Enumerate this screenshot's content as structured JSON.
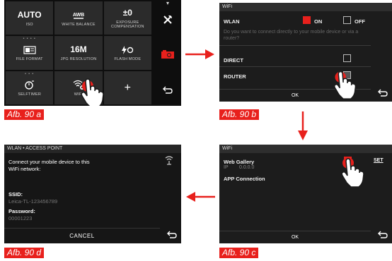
{
  "screen_a": {
    "cells": [
      {
        "value": "AUTO",
        "label": "ISO"
      },
      {
        "value": "AWB",
        "label": "WHITE BALANCE"
      },
      {
        "value": "±0",
        "label": "EXPOSURE\nCOMPENSATION"
      },
      {
        "value": "",
        "label": "FILE FORMAT"
      },
      {
        "value": "16M",
        "label": "JPG RESOLUTION"
      },
      {
        "value": "",
        "label": "FLASH MODE"
      },
      {
        "value": "",
        "label": "SELFTIMER"
      },
      {
        "value": "",
        "label": "WIFI"
      },
      {
        "value": "+",
        "label": ""
      }
    ],
    "caption": "Afb. 90 a"
  },
  "screen_b": {
    "title": "WiFi",
    "wlan_label": "WLAN",
    "on_label": "ON",
    "off_label": "OFF",
    "question": "Do you want to connect directly to your mobile device or via a router?",
    "direct_label": "DIRECT",
    "router_label": "ROUTER",
    "ok_label": "OK",
    "caption": "Afb. 90 b"
  },
  "screen_c": {
    "title": "WiFi",
    "web_gallery_label": "Web Gallery",
    "ip_label": "IP",
    "ip_value": "0.0.0.0",
    "app_connection_label": "APP Connection",
    "set_label": "SET",
    "ok_label": "OK",
    "caption": "Afb. 90 c"
  },
  "screen_d": {
    "title": "WLAN • ACCESS POINT",
    "message": "Connect your mobile device to this WiFi network:",
    "ssid_label": "SSID:",
    "ssid_value": "Leica-TL-123456789",
    "password_label": "Password:",
    "password_value": "00001223",
    "cancel_label": "CANCEL",
    "caption": "Afb. 90 d"
  },
  "colors": {
    "accent": "#e8201c",
    "screen_bg": "#1c1c1c"
  }
}
